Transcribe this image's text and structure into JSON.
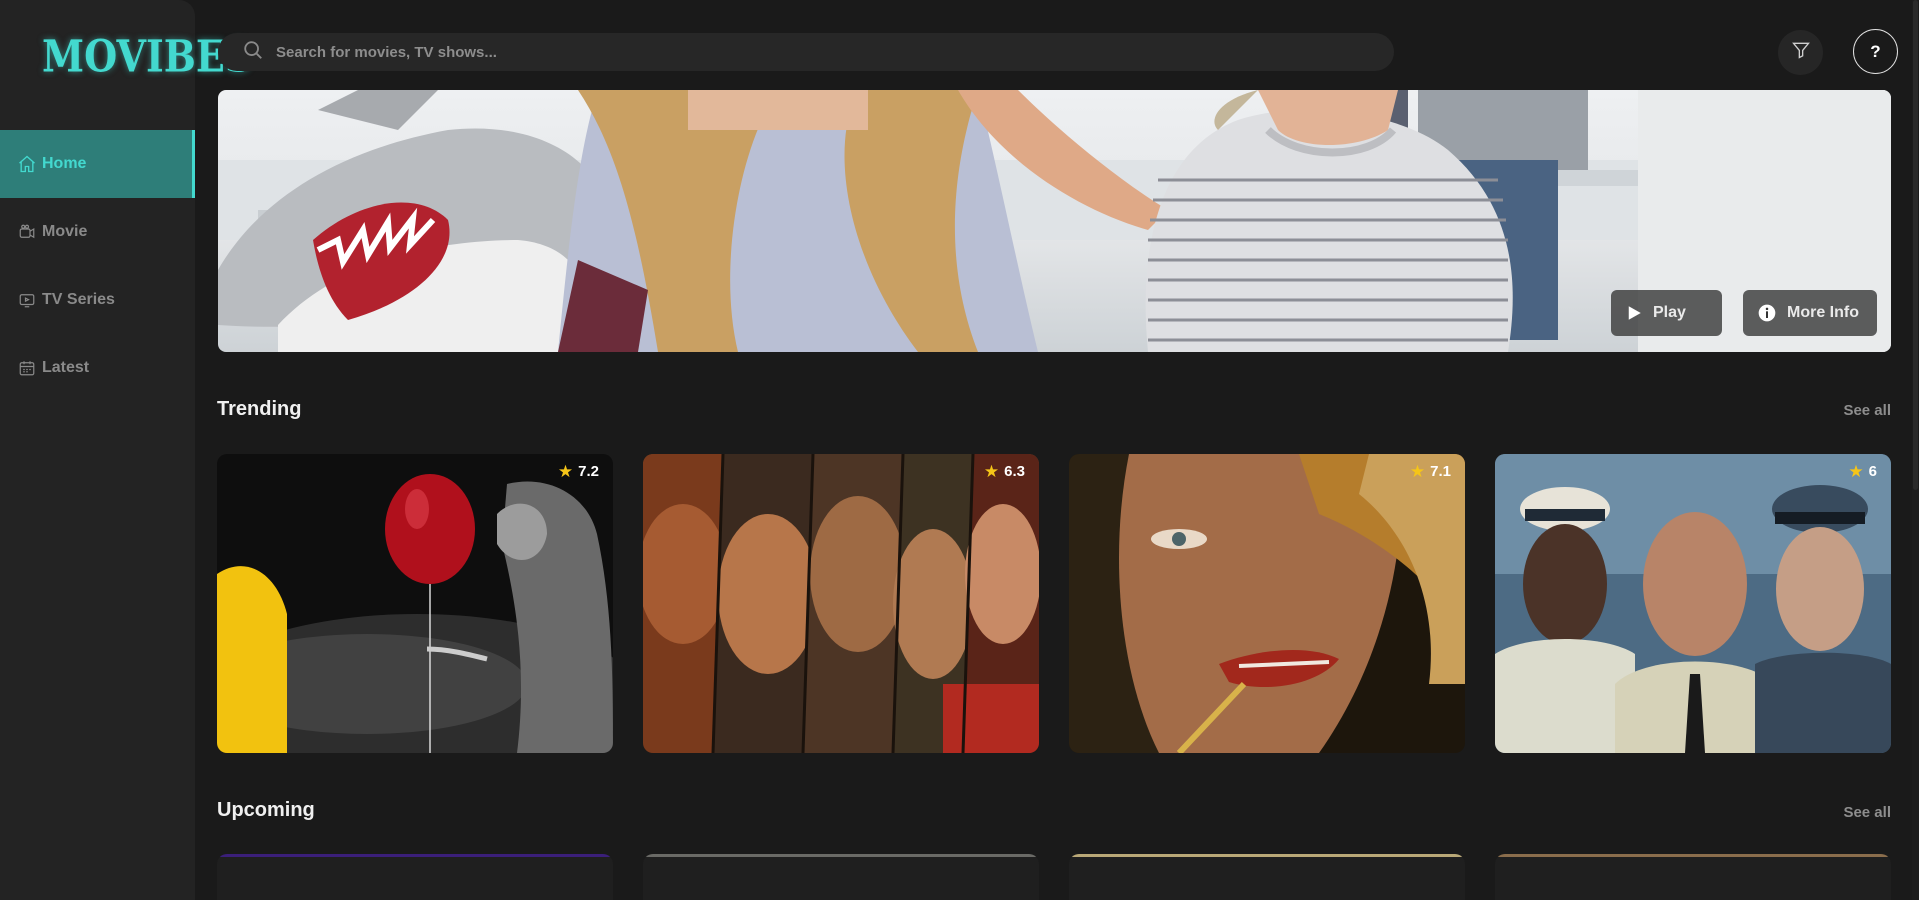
{
  "app": {
    "logo_text": "MOVIBES"
  },
  "sidebar": {
    "items": [
      {
        "label": "Home",
        "icon": "home-icon",
        "active": true
      },
      {
        "label": "Movie",
        "icon": "video-camera-icon",
        "active": false
      },
      {
        "label": "TV Series",
        "icon": "tv-icon",
        "active": false
      },
      {
        "label": "Latest",
        "icon": "calendar-icon",
        "active": false
      }
    ]
  },
  "header": {
    "search": {
      "placeholder": "Search for movies, TV shows...",
      "icon": "search-icon"
    },
    "filter_icon": "filter-icon",
    "help_label": "?"
  },
  "hero": {
    "play_label": "Play",
    "more_info_label": "More Info"
  },
  "sections": {
    "trending": {
      "title": "Trending",
      "see_all": "See all",
      "cards": [
        {
          "rating": "7.2"
        },
        {
          "rating": "6.3"
        },
        {
          "rating": "7.1"
        },
        {
          "rating": "6"
        }
      ]
    },
    "upcoming": {
      "title": "Upcoming",
      "see_all": "See all"
    }
  },
  "colors": {
    "accent": "#43d9cf",
    "active_bg": "#2e7e79",
    "background": "#1a1a1a",
    "sidebar_bg": "#232323",
    "star": "#f5c518"
  }
}
